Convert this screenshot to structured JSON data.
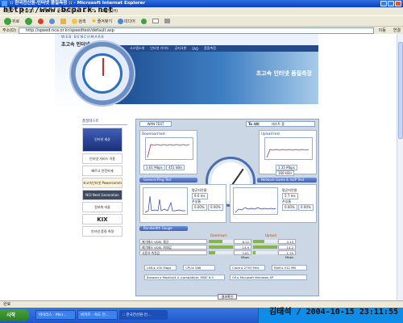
{
  "window": {
    "title": ":: 한국전산원-인터넷 품질측정 :: - Microsoft Internet Explorer",
    "watermark": "http://www.bcpark.net"
  },
  "menu": [
    "파일(F)",
    "편집(E)",
    "보기(V)",
    "즐겨찾기(A)",
    "도구(T)",
    "도움말(H)"
  ],
  "toolbar": {
    "back": "뒤로",
    "search": "검색",
    "favorites": "즐겨찾기",
    "media": "미디어"
  },
  "address": {
    "label": "주소(D)",
    "url": "http://speed.nca.or.kr/speedtest/default.asp",
    "go": "이동",
    "links": "연결"
  },
  "header": {
    "brand": "WEB BENCHMARK",
    "subtitle": "초고속 인터넷 속도테스트",
    "nav": [
      "About",
      "시스템소개",
      "인터넷 가이드",
      "공지사항",
      "FAQ",
      "품질측정"
    ],
    "banner_headline": "초고속 인터넷 품질측정"
  },
  "sidebar": {
    "title": "품질테스트",
    "ads": [
      "인터넷 세상",
      "인터넷 서비스 이용",
      "빠르고 안전하게",
      "초고속인터넷 Powercomm",
      "NGI Next Generation",
      "정보화 마을",
      "KIX",
      "인터넷 품질 측정"
    ]
  },
  "panel": {
    "tab": "WAN TEST",
    "test_value_label": "To 서버",
    "test_value": "테스트 중",
    "download": {
      "title": "Download test",
      "unit": "Mbps",
      "axis": "시간",
      "speed_mbps": "3.61 Mbps",
      "speed_kb": "451 kB/s"
    },
    "upload": {
      "title": "Upload test",
      "unit": "Mbps",
      "axis": "시간",
      "speed_mbps": "1.35 Mbps",
      "speed_kb": "168 kB/s"
    },
    "ping_bar": "General Ping Test",
    "loss_bar": "Network Game & VoIP Test",
    "ping_stats": {
      "avg_label": "평균지연율",
      "avg": "9.6 ms",
      "loss_label": "손실율",
      "loss": "0.00%",
      "extra": "0.00%"
    },
    "game_stats": {
      "avg_label": "평균지연율",
      "avg": "5.7 ms",
      "loss_label": "손실율",
      "loss": "0.00%",
      "extra": "0.00%"
    },
    "bandwidth_bar": "Bandwidth Gauge",
    "download_col": "Download",
    "upload_col": "Upload",
    "rows": [
      {
        "name": "메가패스 VDSL 평균",
        "down": "8.12 Mbps",
        "down_pct": 0.55,
        "up": "4.13 Mbps",
        "up_pct": 0.45
      },
      {
        "name": "메가패스 VDSL 최대값",
        "down": "14.9 Mbps",
        "down_pct": 1.0,
        "up": "14.2 Mbps",
        "up_pct": 1.0
      },
      {
        "name": "사용자 측정값",
        "down": "3.61 Mbps",
        "down_pct": 0.25,
        "up": "1.35 Mbps",
        "up_pct": 0.1
      }
    ],
    "system": {
      "lan": "LAN ▸ 100 Mbps",
      "cpu": "CPU ▸ 586",
      "clock": "Clock ▸ 2793 MHz",
      "ram": "RAM ▸ 512 MB",
      "browser": "Browser ▸ Mozilla/4.0 (compatible; MSIE 6.0",
      "os": "OS ▸ Microsoft Windows XP"
    },
    "result_button": "결과확인"
  },
  "status": {
    "text": "완료"
  },
  "taskbar": {
    "start": "시작",
    "tasks": [
      "바이러스 - Micr...",
      "바까르 - 속도 전...",
      ":: 한국전산원-인..."
    ],
    "stamp": "김태석 / 2004-10-15 23:11:55"
  }
}
